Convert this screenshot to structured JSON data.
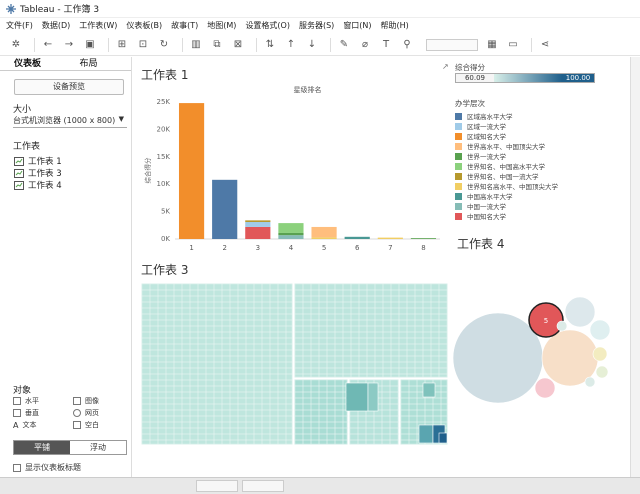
{
  "window": {
    "title": "Tableau - 工作簿 3"
  },
  "menu": [
    "文件(F)",
    "数据(D)",
    "工作表(W)",
    "仪表板(B)",
    "故事(T)",
    "地图(M)",
    "设置格式(O)",
    "服务器(S)",
    "窗口(N)",
    "帮助(H)"
  ],
  "sidebar": {
    "tabs": [
      "仪表板",
      "布局"
    ],
    "preview_button": "设备预览",
    "size_label": "大小",
    "size_value": "台式机浏览器 (1000 x 800)",
    "sheets_label": "工作表",
    "sheets": [
      "工作表 1",
      "工作表 3",
      "工作表 4"
    ],
    "objects_label": "对象",
    "objects": [
      "水平",
      "图像",
      "垂直",
      "网页",
      "文本",
      "空白"
    ],
    "tiled": "平铺",
    "floating": "浮动",
    "show_title": "显示仪表板标题"
  },
  "colors": {
    "accent": "#e15759",
    "teal_light": "#b5e2da",
    "teal_dark": "#1f5f8b"
  },
  "sheet1": {
    "title": "工作表 1",
    "chart_data": {
      "type": "bar",
      "title": "星级排名",
      "ylabel": "综合得分",
      "categories": [
        "1",
        "2",
        "3",
        "4",
        "5",
        "6",
        "7",
        "8"
      ],
      "y_ticks": [
        "0K",
        "5K",
        "10K",
        "15K",
        "20K",
        "25K"
      ],
      "ylim": [
        0,
        25000
      ],
      "stacks": [
        [
          {
            "level": "区域知名大学",
            "value": 24800
          }
        ],
        [
          {
            "level": "区域高水平大学",
            "value": 10800
          }
        ],
        [
          {
            "level": "中国知名大学",
            "value": 2200
          },
          {
            "level": "区域一流大学",
            "value": 900
          },
          {
            "level": "世界知名、中国一流大学",
            "value": 300
          }
        ],
        [
          {
            "level": "中国一流大学",
            "value": 700
          },
          {
            "level": "世界一流大学",
            "value": 400
          },
          {
            "level": "世界知名、中国高水平大学",
            "value": 1800
          }
        ],
        [
          {
            "level": "世界知名高水平、中国顶尖大学",
            "value": 300
          },
          {
            "level": "世界高水平、中国顶尖大学",
            "value": 1900
          }
        ],
        [
          {
            "level": "中国高水平大学",
            "value": 400
          }
        ],
        [
          {
            "level": "世界知名高水平、中国顶尖大学",
            "value": 250
          }
        ],
        [
          {
            "level": "世界一流大学",
            "value": 150
          }
        ]
      ]
    }
  },
  "legend": {
    "score_title": "综合得分",
    "score_min": "60.09",
    "score_max": "100.00",
    "category_title": "办学层次",
    "categories": [
      {
        "name": "区域高水平大学",
        "color": "#4e79a7"
      },
      {
        "name": "区域一流大学",
        "color": "#a0cbe8"
      },
      {
        "name": "区域知名大学",
        "color": "#f28e2b"
      },
      {
        "name": "世界高水平、中国顶尖大学",
        "color": "#ffbe7d"
      },
      {
        "name": "世界一流大学",
        "color": "#59a14f"
      },
      {
        "name": "世界知名、中国高水平大学",
        "color": "#8cd17d"
      },
      {
        "name": "世界知名、中国一流大学",
        "color": "#b6992d"
      },
      {
        "name": "世界知名高水平、中国顶尖大学",
        "color": "#f1ce63"
      },
      {
        "name": "中国高水平大学",
        "color": "#499894"
      },
      {
        "name": "中国一流大学",
        "color": "#86bcb6"
      },
      {
        "name": "中国知名大学",
        "color": "#e15759"
      }
    ]
  },
  "sheet3": {
    "title": "工作表 3"
  },
  "sheet4": {
    "title": "工作表 4",
    "highlight_label": "5"
  }
}
